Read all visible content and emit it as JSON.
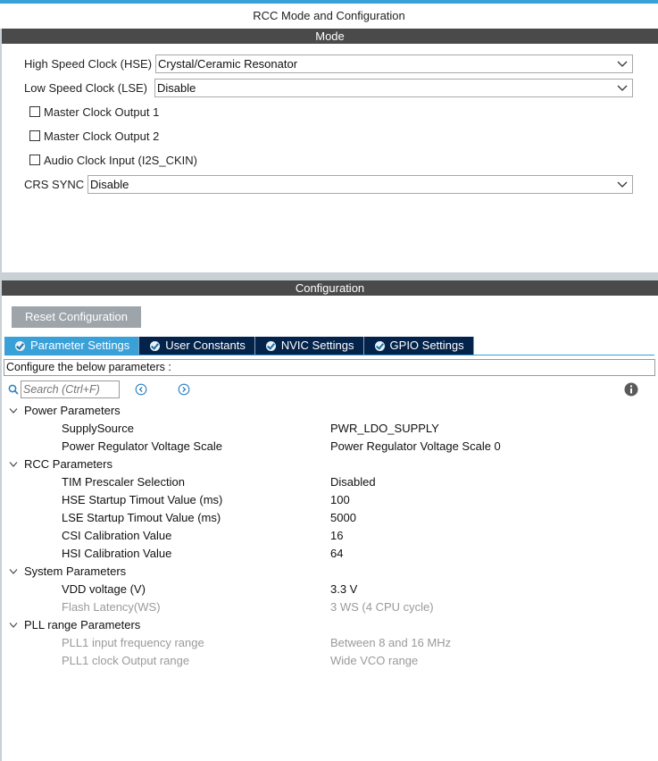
{
  "window": {
    "title": "RCC Mode and Configuration"
  },
  "mode": {
    "header": "Mode",
    "hse": {
      "label": "High Speed Clock (HSE)",
      "value": "Crystal/Ceramic Resonator"
    },
    "lse": {
      "label": "Low Speed Clock (LSE)",
      "value": "Disable"
    },
    "checks": [
      {
        "label": "Master Clock Output 1",
        "checked": false
      },
      {
        "label": "Master Clock Output 2",
        "checked": false
      },
      {
        "label": "Audio Clock Input (I2S_CKIN)",
        "checked": false
      }
    ],
    "crs": {
      "label": "CRS SYNC",
      "value": "Disable"
    }
  },
  "config": {
    "header": "Configuration",
    "reset_label": "Reset Configuration",
    "tabs": [
      {
        "label": "Parameter Settings",
        "active": true
      },
      {
        "label": "User Constants",
        "active": false
      },
      {
        "label": "NVIC Settings",
        "active": false
      },
      {
        "label": "GPIO Settings",
        "active": false
      }
    ],
    "info_text": "Configure the below parameters :",
    "search_placeholder": "Search (Ctrl+F)",
    "groups": [
      {
        "name": "Power Parameters",
        "params": [
          {
            "name": "SupplySource",
            "value": "PWR_LDO_SUPPLY",
            "enabled": true
          },
          {
            "name": "Power Regulator Voltage Scale",
            "value": "Power Regulator Voltage Scale 0",
            "enabled": true
          }
        ]
      },
      {
        "name": "RCC Parameters",
        "params": [
          {
            "name": "TIM Prescaler Selection",
            "value": "Disabled",
            "enabled": true
          },
          {
            "name": "HSE Startup Timout Value (ms)",
            "value": "100",
            "enabled": true
          },
          {
            "name": "LSE Startup Timout Value (ms)",
            "value": "5000",
            "enabled": true
          },
          {
            "name": "CSI Calibration Value",
            "value": "16",
            "enabled": true
          },
          {
            "name": "HSI Calibration Value",
            "value": "64",
            "enabled": true
          }
        ]
      },
      {
        "name": "System Parameters",
        "params": [
          {
            "name": "VDD voltage (V)",
            "value": "3.3 V",
            "enabled": true
          },
          {
            "name": "Flash Latency(WS)",
            "value": "3 WS (4 CPU cycle)",
            "enabled": false
          }
        ]
      },
      {
        "name": "PLL range Parameters",
        "params": [
          {
            "name": "PLL1 input frequency range",
            "value": "Between 8 and 16 MHz",
            "enabled": false
          },
          {
            "name": "PLL1 clock Output range",
            "value": "Wide VCO range",
            "enabled": false
          }
        ]
      }
    ]
  },
  "icons": {
    "search": "search-icon",
    "prev": "chevron-left-circle-icon",
    "next": "chevron-right-circle-icon",
    "info": "info-icon",
    "tab_check": "check-circle-icon"
  },
  "colors": {
    "accent": "#3aa0d8",
    "tab_inactive": "#03234b",
    "section_header": "#4a4a4a",
    "reset_button": "#9da4aa",
    "disabled_text": "#9a9a9a"
  }
}
